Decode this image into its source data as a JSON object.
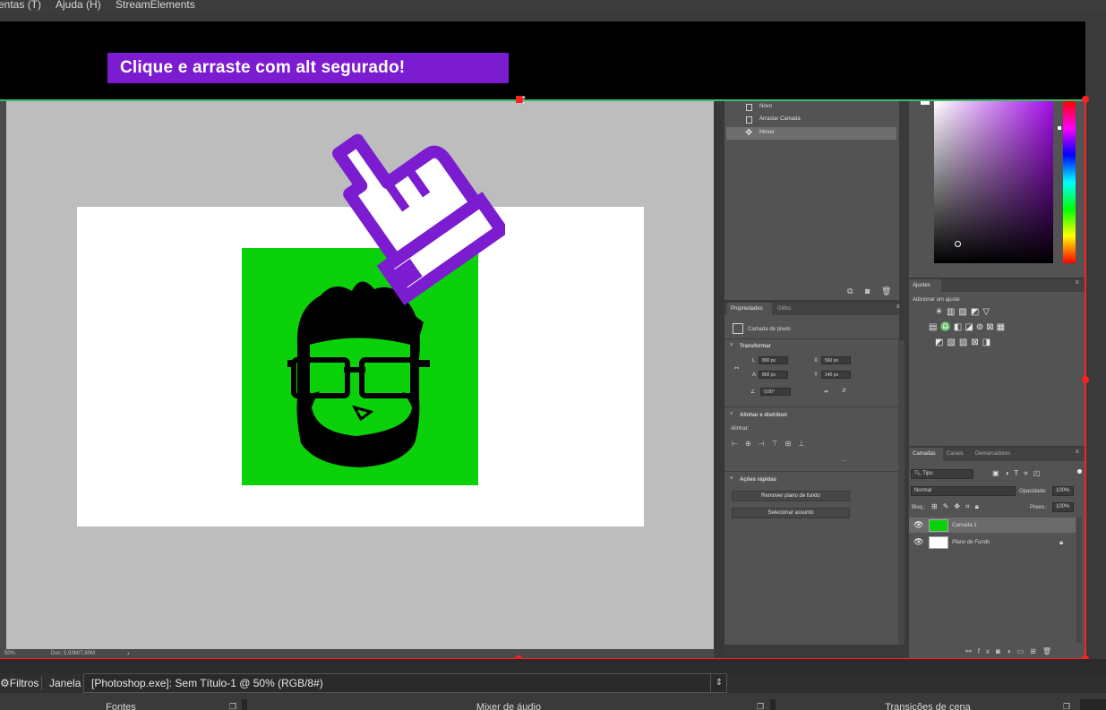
{
  "menubar": {
    "items": [
      "entas (T)",
      "Ajuda (H)",
      "StreamElements"
    ]
  },
  "banner": {
    "text": "Clique e arraste com alt segurado!"
  },
  "history": {
    "items": [
      "Novo",
      "Arrastar Camada",
      "Mover"
    ],
    "selected_index": 2
  },
  "status_bar": {
    "zoom": "50%",
    "doc": "Doc: 5,93M/7,80M"
  },
  "properties": {
    "tabs": [
      "Propriedades",
      "Glifos"
    ],
    "layer_type": "Camada de pixels",
    "transform": {
      "title": "Transformar",
      "L_label": "L",
      "L_value": "800 px",
      "A_label": "A",
      "A_value": "800 px",
      "X_label": "X",
      "X_value": "560 px",
      "Y_label": "Y",
      "Y_value": "140 px",
      "angle": "0,00°"
    },
    "align": {
      "title": "Alinhar e distribuir",
      "sub": "Alinhar:",
      "more": "..."
    },
    "quick": {
      "title": "Ações rápidas",
      "buttons": [
        "Remover plano de fundo",
        "Selecionar assunto"
      ]
    }
  },
  "adjustments": {
    "tab": "Ajustes",
    "subtitle": "Adicionar um ajuste"
  },
  "layers": {
    "tabs": [
      "Camadas",
      "Canais",
      "Demarcadores"
    ],
    "filter": "Tipo",
    "blend": "Normal",
    "opacity_label": "Opacidade:",
    "opacity_value": "100%",
    "lock_label": "Bloq.:",
    "fill_label": "Preen.:",
    "fill_value": "100%",
    "rows": [
      {
        "name": "Camada 1",
        "selected": true
      },
      {
        "name": "Plano de Fundo",
        "selected": false
      }
    ]
  },
  "obs": {
    "filters": "Filtros",
    "janela_label": "Janela",
    "janela_value": "[Photoshop.exe]: Sem Título-1 @ 50% (RGB/8#)",
    "docks": [
      "Fontes",
      "Mixer de áudio",
      "Transições de cena"
    ]
  },
  "colors": {
    "banner_bg": "#7b1cd1",
    "selection_red": "#ff2020",
    "green_layer": "#0bd10b",
    "hand_outline": "#7b1cd1"
  }
}
